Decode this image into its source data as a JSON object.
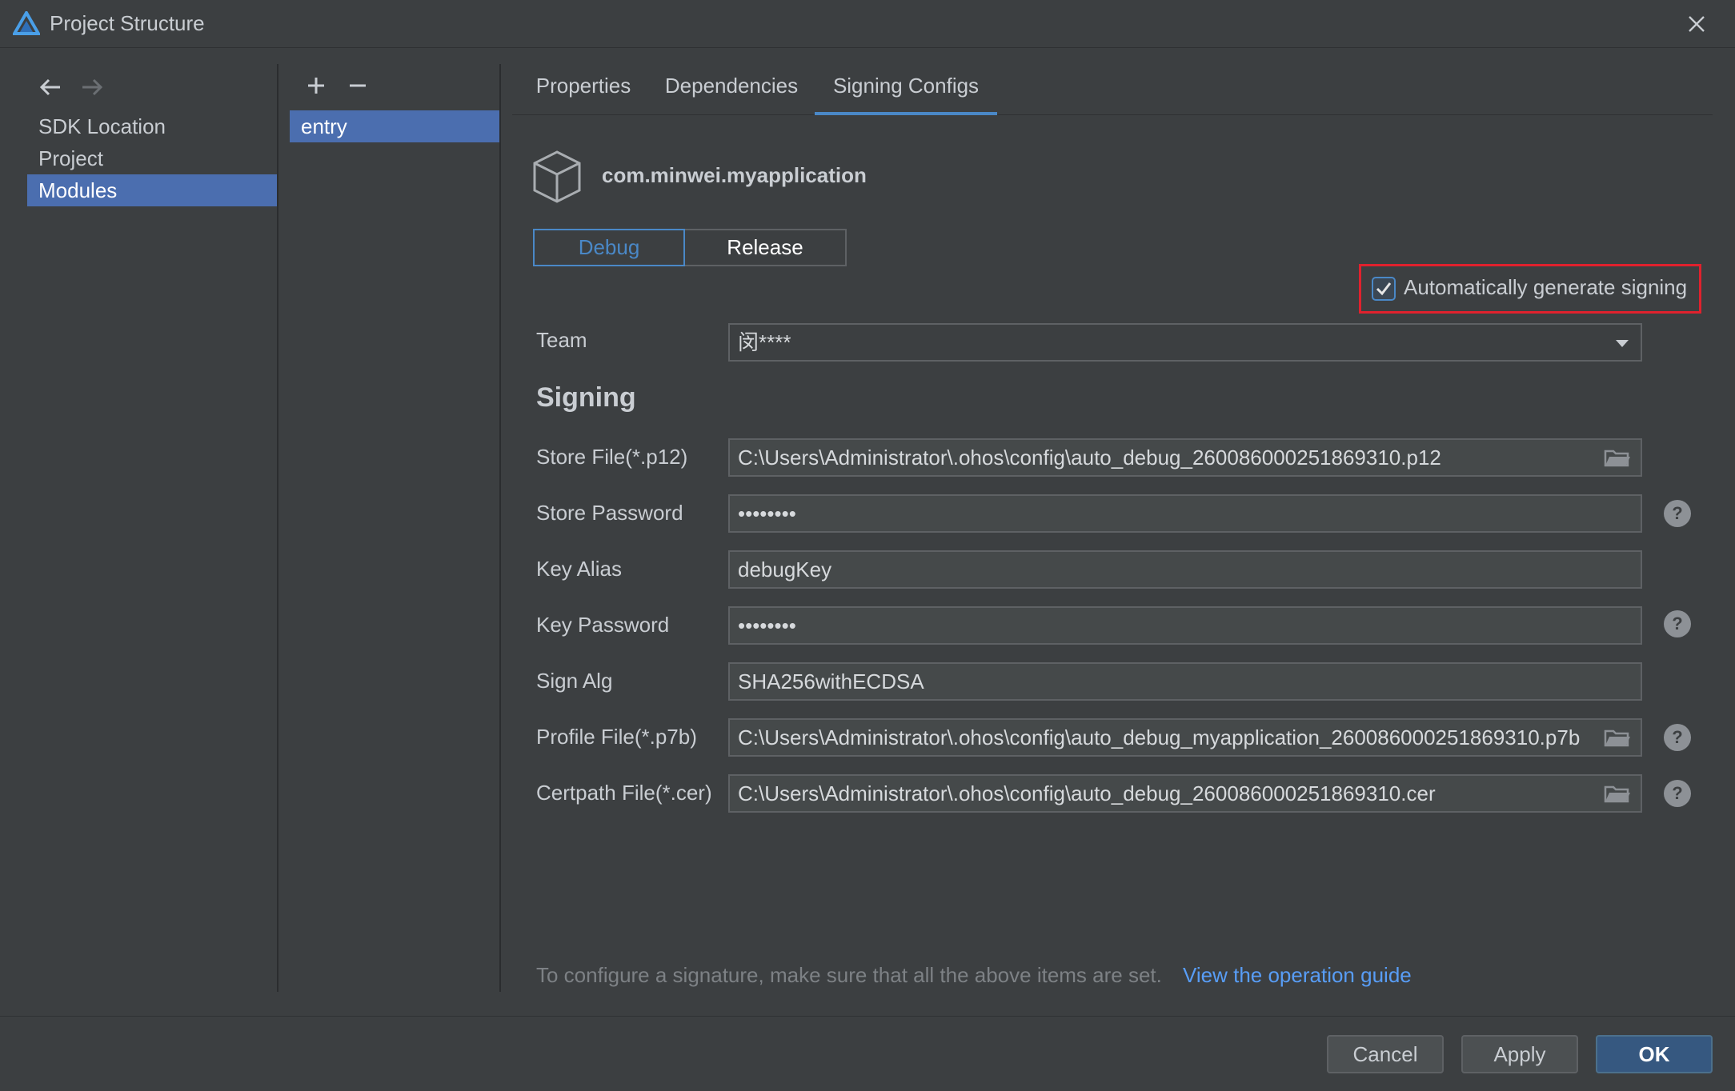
{
  "window": {
    "title": "Project Structure"
  },
  "sidebar": {
    "items": [
      {
        "label": "SDK Location"
      },
      {
        "label": "Project"
      },
      {
        "label": "Modules"
      }
    ]
  },
  "modules": {
    "items": [
      {
        "label": "entry"
      }
    ]
  },
  "tabs": [
    {
      "label": "Properties"
    },
    {
      "label": "Dependencies"
    },
    {
      "label": "Signing Configs"
    }
  ],
  "module_header": {
    "package_name": "com.minwei.myapplication"
  },
  "build_type": {
    "debug_label": "Debug",
    "release_label": "Release",
    "selected": "Debug"
  },
  "auto_signing": {
    "label": "Automatically generate signing",
    "checked": true
  },
  "form": {
    "team_label": "Team",
    "team_value": "闵****",
    "section_title": "Signing",
    "store_file_label": "Store File(*.p12)",
    "store_file_value": "C:\\Users\\Administrator\\.ohos\\config\\auto_debug_260086000251869310.p12",
    "store_password_label": "Store Password",
    "store_password_value": "••••••••",
    "key_alias_label": "Key Alias",
    "key_alias_value": "debugKey",
    "key_password_label": "Key Password",
    "key_password_value": "••••••••",
    "sign_alg_label": "Sign Alg",
    "sign_alg_value": "SHA256withECDSA",
    "profile_file_label": "Profile File(*.p7b)",
    "profile_file_value": "C:\\Users\\Administrator\\.ohos\\config\\auto_debug_myapplication_260086000251869310.p7b",
    "certpath_file_label": "Certpath File(*.cer)",
    "certpath_file_value": "C:\\Users\\Administrator\\.ohos\\config\\auto_debug_260086000251869310.cer"
  },
  "footer": {
    "hint": "To configure a signature, make sure that all the above items are set.",
    "guide_link": "View the operation guide",
    "cancel_label": "Cancel",
    "apply_label": "Apply",
    "ok_label": "OK"
  },
  "help_symbol": "?",
  "colors": {
    "background": "#3c3f41",
    "selection": "#4b6eaf",
    "accent": "#4a88c7",
    "highlight_border": "#e0212d",
    "link": "#589df6"
  }
}
